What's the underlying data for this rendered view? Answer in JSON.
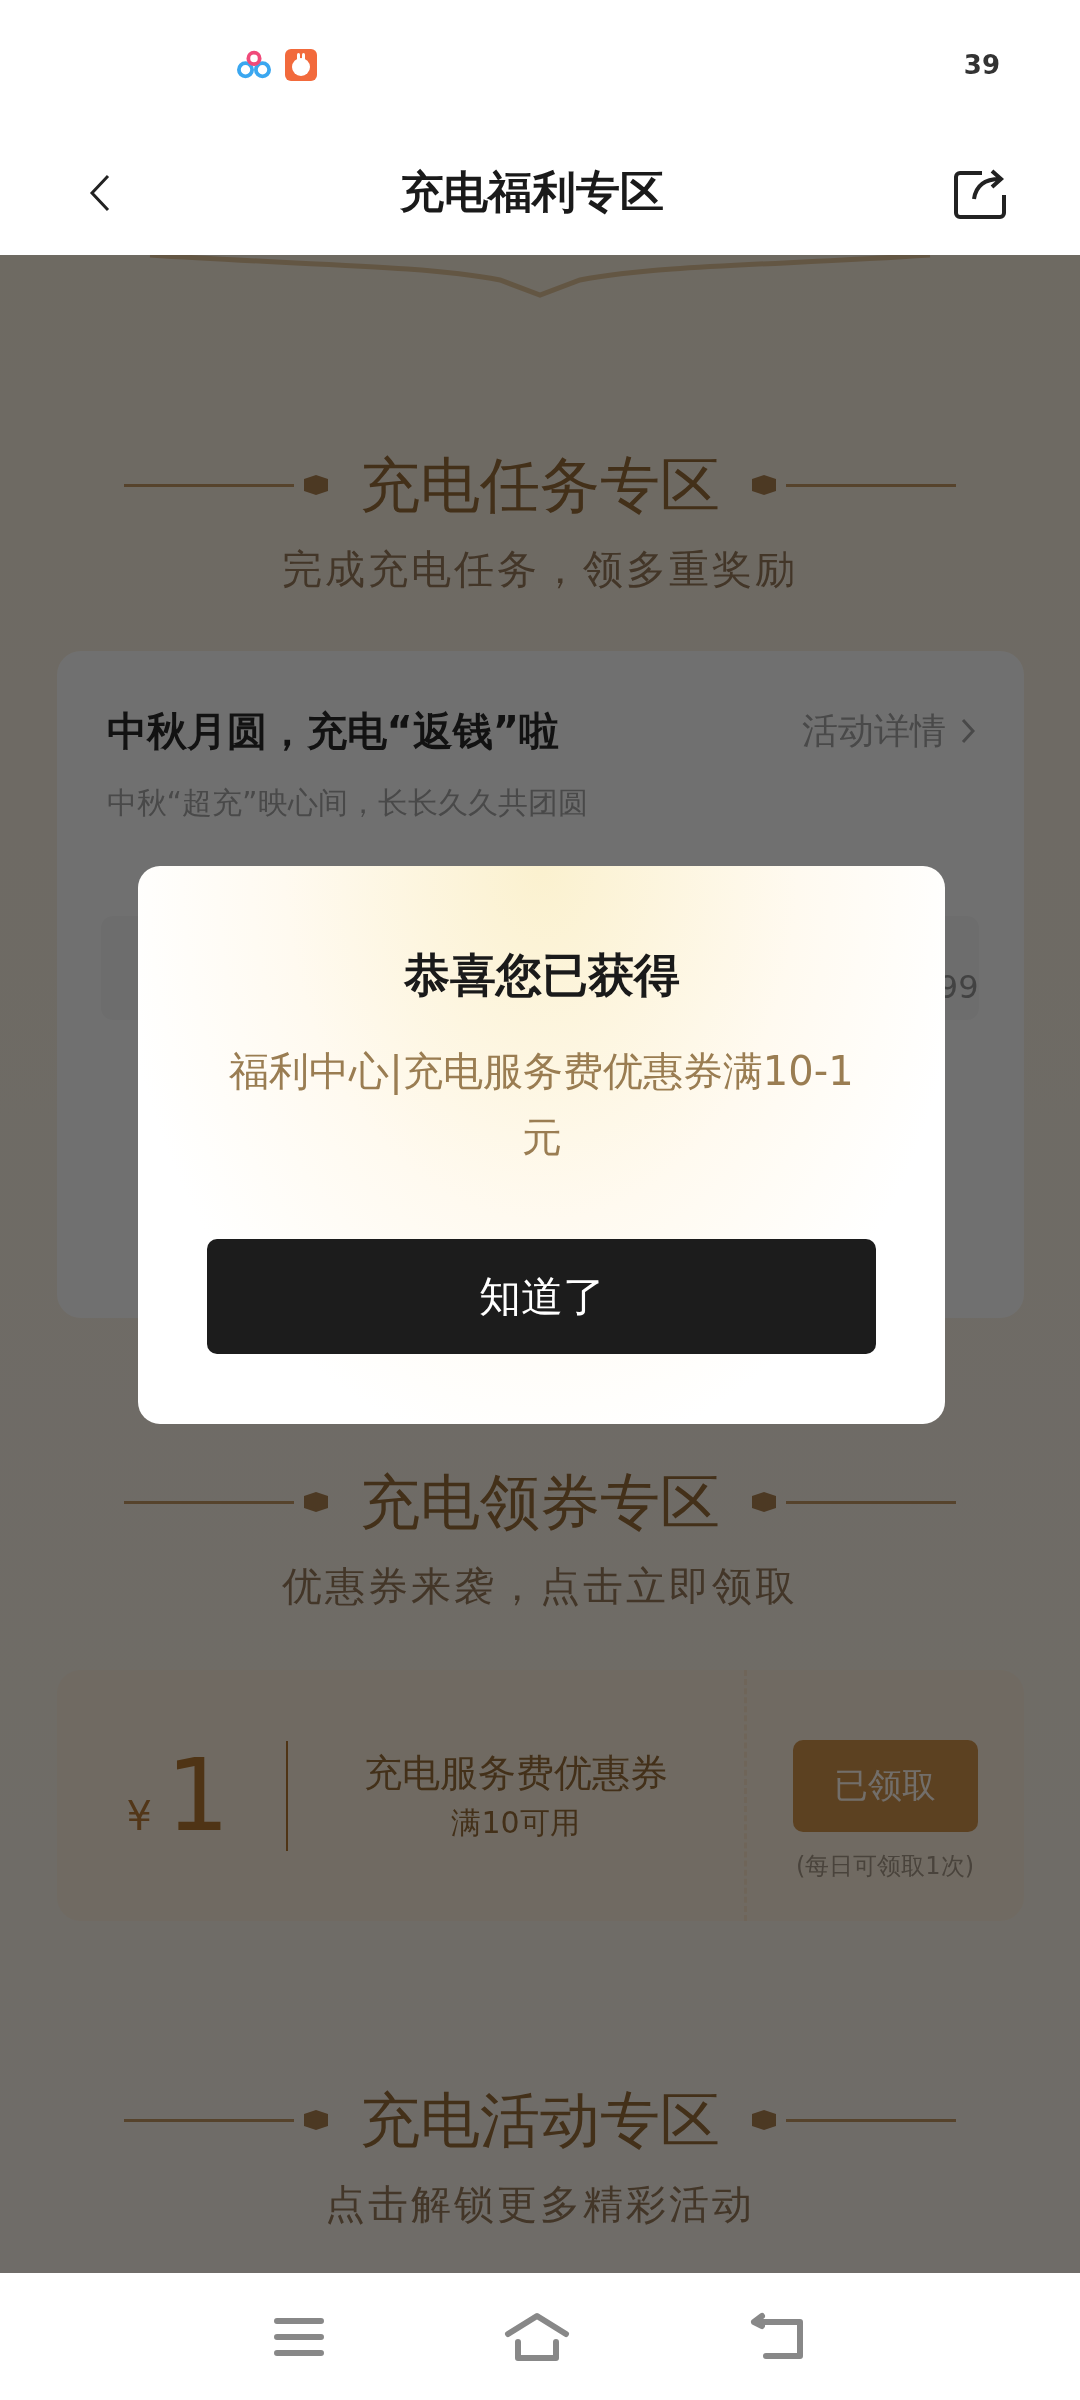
{
  "status_bar": {
    "time": "39"
  },
  "nav": {
    "title": "充电福利专区"
  },
  "sections": [
    {
      "title": "充电任务专区",
      "subtitle": "完成充电任务，领多重奖励"
    },
    {
      "title": "充电领券专区",
      "subtitle": "优惠券来袭，点击立即领取"
    },
    {
      "title": "充电活动专区",
      "subtitle": "点击解锁更多精彩活动"
    }
  ],
  "task_card": {
    "title": "中秋月圆，充电“返钱”啦",
    "link": "活动详情",
    "subtitle": "中秋“超充”映心间，长长久久共团圆",
    "peek_text": "99"
  },
  "coupon": {
    "currency": "¥",
    "amount": "1",
    "name": "充电服务费优惠券",
    "condition": "满10可用",
    "button": "已领取",
    "claimed": true,
    "limit": "(每日可领取1次)"
  },
  "dialog": {
    "title": "恭喜您已获得",
    "message": "福利中心|充电服务费优惠券满10-1元",
    "button": "知道了"
  }
}
